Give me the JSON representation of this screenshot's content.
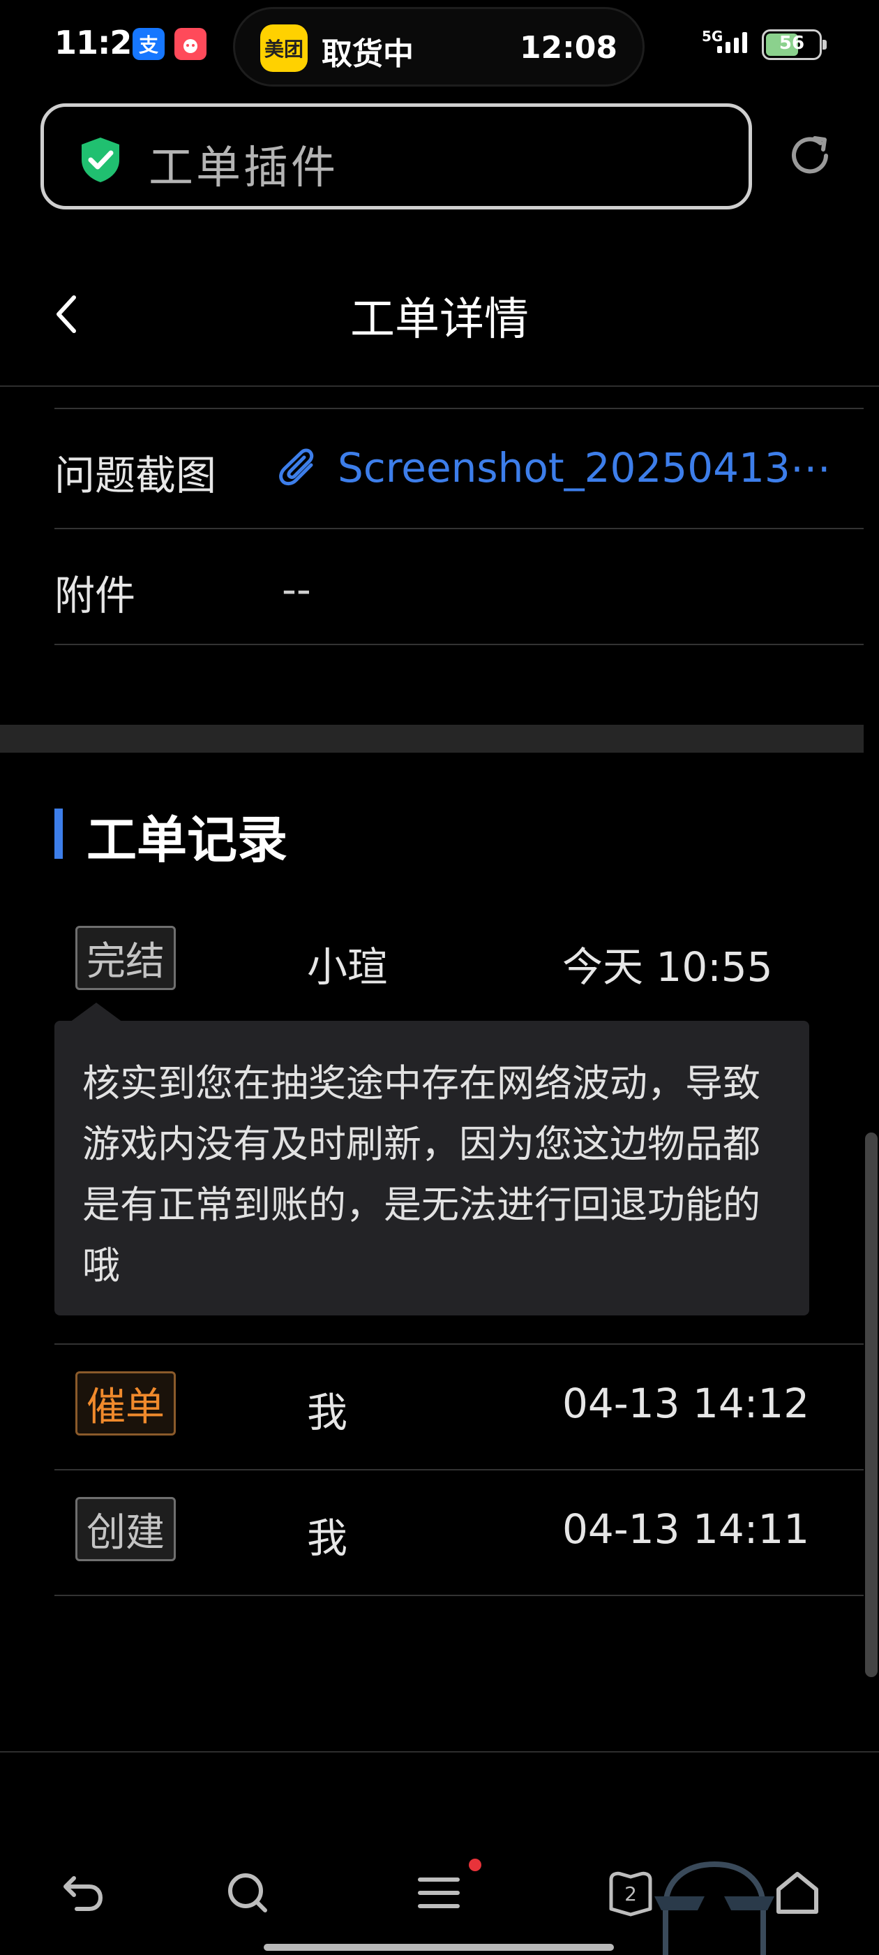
{
  "status_bar": {
    "time": "11:29",
    "app_badge_1": "支",
    "app_badge_2": "",
    "island_app": "美团",
    "island_text": "取货中",
    "island_time": "12:08",
    "network": "5G",
    "battery": "56",
    "colors": {
      "alipay": "#1677ff",
      "meituan": "#ffd100",
      "taobao": "#ff4a5a"
    }
  },
  "browser": {
    "url_title": "工单插件",
    "icons": {
      "secure": "shield-check-icon",
      "reload": "reload-icon"
    }
  },
  "header": {
    "title": "工单详情",
    "back_icon": "chevron-left-icon"
  },
  "details": [
    {
      "label": "问题截图",
      "value": "Screenshot_20250413⋯",
      "icon": "paperclip-icon",
      "link_color": "#3d7eea"
    },
    {
      "label": "附件",
      "value": "--"
    }
  ],
  "records": {
    "section_title": "工单记录",
    "items": [
      {
        "tag": "完结",
        "tag_color": "gray",
        "user": "小瑄",
        "time": "今天 10:55",
        "message": "核实到您在抽奖途中存在网络波动，导致游戏内没有及时刷新，因为您这边物品都是有正常到账的，是无法进行回退功能的哦"
      },
      {
        "tag": "催单",
        "tag_color": "orange",
        "user": "我",
        "time": "04-13 14:12"
      },
      {
        "tag": "创建",
        "tag_color": "gray",
        "user": "我",
        "time": "04-13 14:11"
      }
    ]
  },
  "bottom_nav": {
    "icons": [
      "back-arrow-icon",
      "search-icon",
      "menu-icon",
      "tabs-icon",
      "home-icon"
    ],
    "tab_count": "2"
  }
}
